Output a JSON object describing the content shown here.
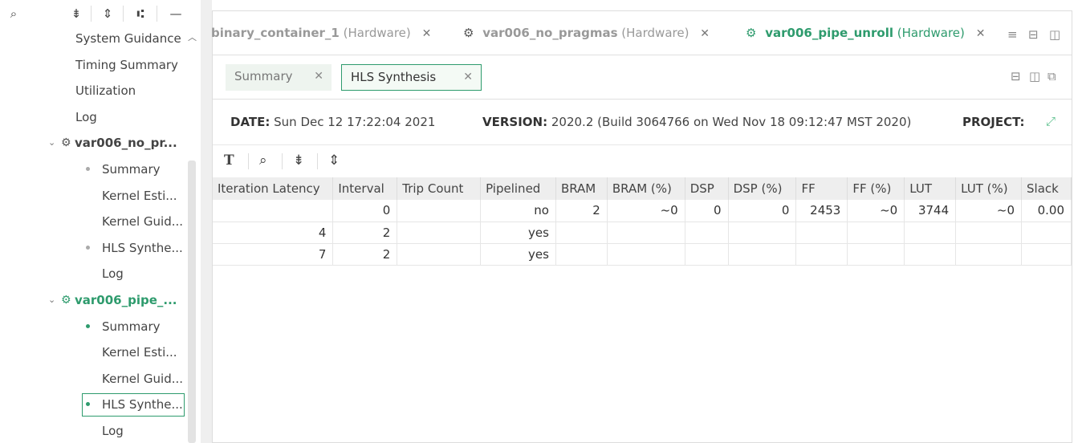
{
  "left_panel": {
    "toolbar": {
      "search_icon": "⌕",
      "collapse_icon": "⇟",
      "expand_icon": "⇕",
      "hierarchy_icon": "⑆",
      "minimize_icon": "—"
    },
    "tree": [
      {
        "label": "System Guidance",
        "level": 2
      },
      {
        "label": "Timing Summary",
        "level": 2
      },
      {
        "label": "Utilization",
        "level": 2
      },
      {
        "label": "Log",
        "level": 2
      },
      {
        "label": "var006_no_pr...",
        "level": 1,
        "expanded": true
      },
      {
        "label": "Summary",
        "level": 3,
        "bullet": true
      },
      {
        "label": "Kernel Esti...",
        "level": 3
      },
      {
        "label": "Kernel Guid...",
        "level": 3
      },
      {
        "label": "HLS Synthe...",
        "level": 3,
        "bullet": true
      },
      {
        "label": "Log",
        "level": 3
      },
      {
        "label": "var006_pipe_...",
        "level": 1,
        "expanded": true,
        "active": true
      },
      {
        "label": "Summary",
        "level": 3,
        "bullet": true,
        "green": true
      },
      {
        "label": "Kernel Esti...",
        "level": 3
      },
      {
        "label": "Kernel Guid...",
        "level": 3
      },
      {
        "label": "HLS Synthe...",
        "level": 3,
        "bullet": true,
        "green": true,
        "selected": true
      },
      {
        "label": "Log",
        "level": 3
      }
    ]
  },
  "file_tabs": [
    {
      "name": "binary_container_1",
      "sub": "(Hardware)",
      "active": false
    },
    {
      "name": "var006_no_pragmas",
      "sub": "(Hardware)",
      "active": false
    },
    {
      "name": "var006_pipe_unroll",
      "sub": "(Hardware)",
      "active": true
    }
  ],
  "close_glyph": "✕",
  "sub_tabs": [
    {
      "label": "Summary",
      "active": false
    },
    {
      "label": "HLS Synthesis",
      "active": true
    }
  ],
  "info": {
    "date_label": "DATE:",
    "date_value": "Sun Dec 12 17:22:04 2021",
    "version_label": "VERSION:",
    "version_value": "2020.2 (Build 3064766 on Wed Nov 18 09:12:47 MST 2020)",
    "project_label": "PROJECT:"
  },
  "table": {
    "columns": [
      "Iteration Latency",
      "Interval",
      "Trip Count",
      "Pipelined",
      "BRAM",
      "BRAM (%)",
      "DSP",
      "DSP (%)",
      "FF",
      "FF (%)",
      "LUT",
      "LUT (%)",
      "Slack"
    ],
    "rows": [
      [
        "",
        "0",
        "",
        "no",
        "2",
        "~0",
        "0",
        "0",
        "2453",
        "~0",
        "3744",
        "~0",
        "0.00"
      ],
      [
        "4",
        "2",
        "",
        "yes",
        "",
        "",
        "",
        "",
        "",
        "",
        "",
        "",
        ""
      ],
      [
        "7",
        "2",
        "",
        "yes",
        "",
        "",
        "",
        "",
        "",
        "",
        "",
        "",
        ""
      ]
    ]
  }
}
